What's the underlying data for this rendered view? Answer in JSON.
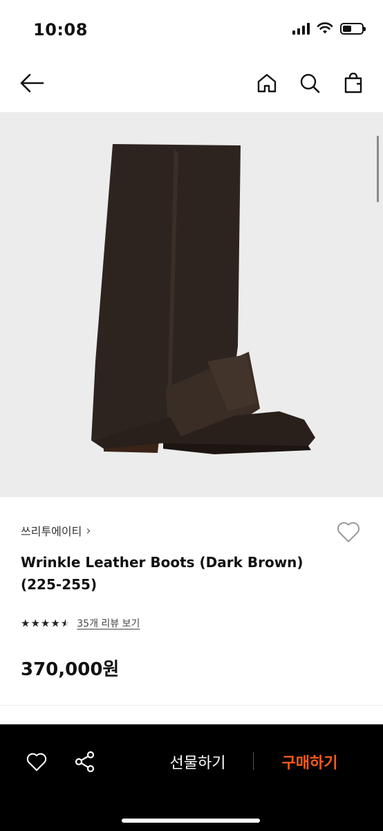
{
  "status_bar": {
    "time": "10:08",
    "battery_level": 0.45
  },
  "nav": {
    "icons": [
      "back-arrow-icon",
      "home-icon",
      "search-icon",
      "shopping-bag-icon"
    ]
  },
  "product": {
    "brand": "쓰리투에이티",
    "brand_chevron": "›",
    "title": "Wrinkle Leather Boots (Dark Brown) (225-255)",
    "rating": 4.5,
    "review_link": "35개 리뷰 보기",
    "price": "370,000원",
    "image_icon": "boot-image"
  },
  "bottom_bar": {
    "gift_label": "선물하기",
    "buy_label": "구매하기",
    "icons": [
      "heart-icon",
      "share-icon"
    ]
  },
  "colors": {
    "accent": "#ff5a1f",
    "bottom_bar_bg": "#000000",
    "image_bg": "#ececec",
    "boot": "#2e241f"
  }
}
